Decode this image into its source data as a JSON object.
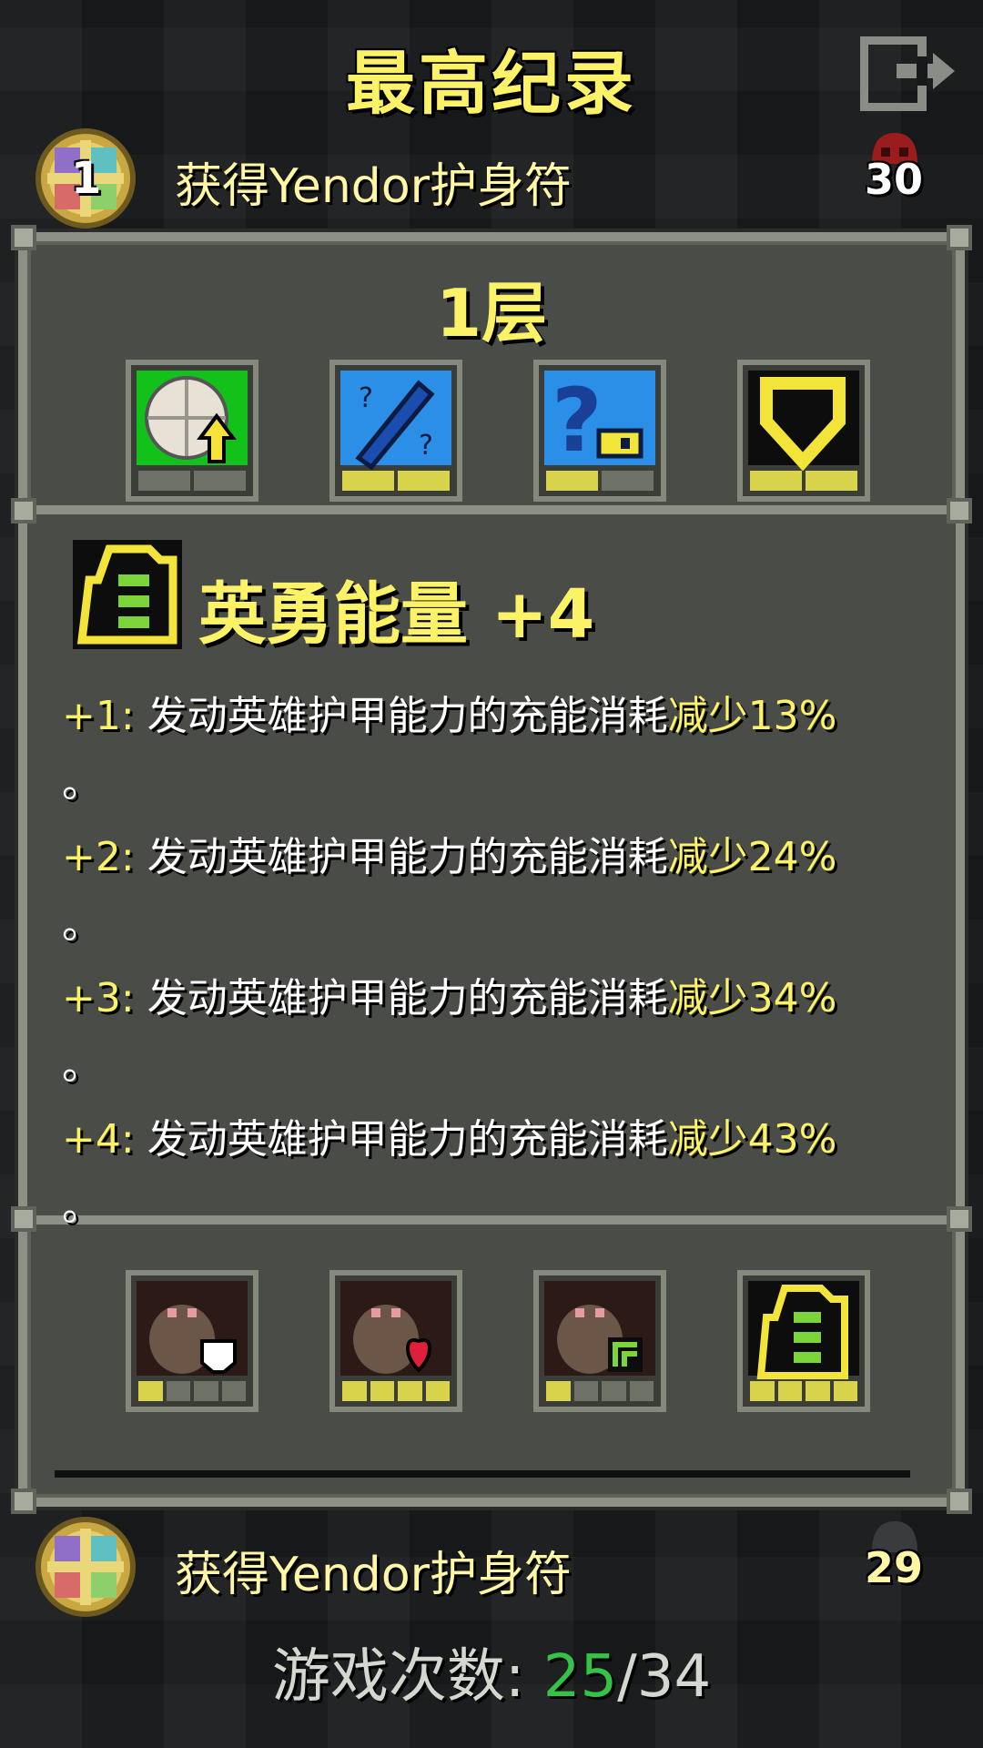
{
  "header": {
    "title": "最高纪录"
  },
  "records": [
    {
      "rank": "1",
      "description": "获得Yendor护身符",
      "depth": "30"
    },
    {
      "rank": "",
      "description": "获得Yendor护身符",
      "depth": "29"
    }
  ],
  "detail": {
    "floor_label": "1层",
    "top_items": [
      "scroll-icon",
      "wand-icon",
      "key-icon",
      "armor-icon"
    ],
    "bottom_items": [
      {
        "icon": "rat-white-icon",
        "pips_on": 1,
        "pips": 4
      },
      {
        "icon": "rat-heart-icon",
        "pips_on": 4,
        "pips": 4
      },
      {
        "icon": "rat-green-icon",
        "pips_on": 1,
        "pips": 4
      },
      {
        "icon": "heroic-energy-icon",
        "pips_on": 4,
        "pips": 4
      }
    ]
  },
  "tooltip": {
    "title": "英勇能量 +4",
    "lines": [
      {
        "level": "+1:",
        "text": "发动英雄护甲能力的充能消耗",
        "highlight": "减少13%",
        "end": "。"
      },
      {
        "level": "+2:",
        "text": "发动英雄护甲能力的充能消耗",
        "highlight": "减少24%",
        "end": "。"
      },
      {
        "level": "+3:",
        "text": "发动英雄护甲能力的充能消耗",
        "highlight": "减少34%",
        "end": "。"
      },
      {
        "level": "+4:",
        "text": "发动英雄护甲能力的充能消耗",
        "highlight": "减少43%",
        "end": "。"
      }
    ]
  },
  "footer": {
    "label": "游戏次数:",
    "current": "25",
    "separator": "/",
    "total": "34"
  },
  "colors": {
    "title_yellow": "#fbf267",
    "games_green": "#35c246",
    "panel": "#4a4c47"
  }
}
